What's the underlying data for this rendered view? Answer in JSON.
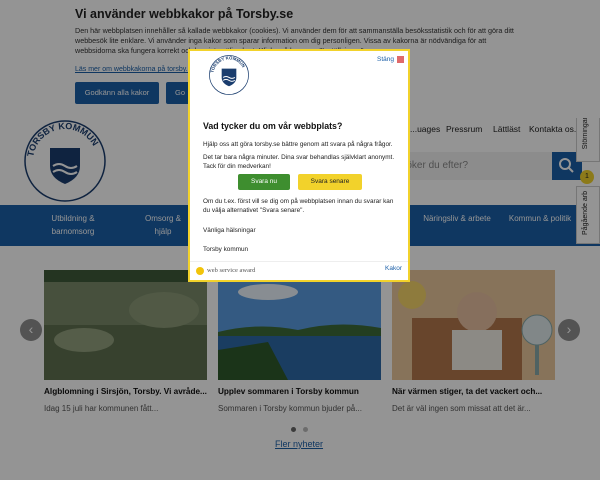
{
  "cookie_banner": {
    "title": "Vi använder webbkakor på Torsby.se",
    "body": "Den här webbplatsen innehåller så kallade webbkakor (cookies). Vi använder dem för att sammanställa besöksstatistik och för att göra ditt webbesök lite enklare. Vi använder inga kakor som sparar information om dig personligen. Vissa av kakorna är nödvändiga för att webbsidorna ska fungera korrekt och kan inte väljas bort. Klicka på knappen \"Inställningar\".",
    "more_link": "Läs mer om webbkakorna på torsby.se",
    "accept_all": "Godkänn alla kakor",
    "second_button": "Go"
  },
  "header": {
    "logo_text": "TORSBY KOMMUN",
    "nav": [
      "...uages",
      "Pressrum",
      "Lättläst",
      "Kontakta os..."
    ],
    "search_placeholder": "...öker du efter?"
  },
  "main_menu": [
    {
      "label": "Utbildning & barnomsorg"
    },
    {
      "label": "Omsorg & hjälp"
    },
    {
      "label": "Näringsliv & arbete"
    },
    {
      "label": "Kommun & politik"
    }
  ],
  "news": [
    {
      "title": "Algblomning i Sirsjön, Torsby. Vi avråde...",
      "summary": "Idag 15 juli har kommunen fått..."
    },
    {
      "title": "Upplev sommaren i Torsby kommun",
      "summary": "Sommaren i Torsby kommun bjuder på..."
    },
    {
      "title": "När värmen stiger, ta det vackert och...",
      "summary": "Det är väl ingen som missat att det är..."
    }
  ],
  "more_news": "Fler nyheter",
  "side_tabs": {
    "disruptions": "Störningar",
    "disruptions_count": "1",
    "ongoing": "Pågående arb"
  },
  "survey": {
    "close": "Stäng",
    "logo_text": "TORSBY KOMMUN",
    "title": "Vad tycker du om vår webbplats?",
    "intro": "Hjälp oss att göra torsby.se bättre genom att svara på några frågor.",
    "duration": "Det tar bara några minuter. Dina svar behandlas självklart anonymt.",
    "thanks": "Tack för din medverkan!",
    "answer_now": "Svara nu",
    "answer_later": "Svara senare",
    "visit_note": "Om du t.ex. först vill se dig om på webbplatsen innan du svarar kan du välja alternativet \"Svara senare\".",
    "regards": "Vänliga hälsningar",
    "signature": "Torsby kommun",
    "award": "web service award",
    "cookies": "Kakor"
  },
  "colors": {
    "brand_blue": "#1b5fa8",
    "survey_yellow": "#f2d22b",
    "yes_green": "#3e8e2f"
  }
}
